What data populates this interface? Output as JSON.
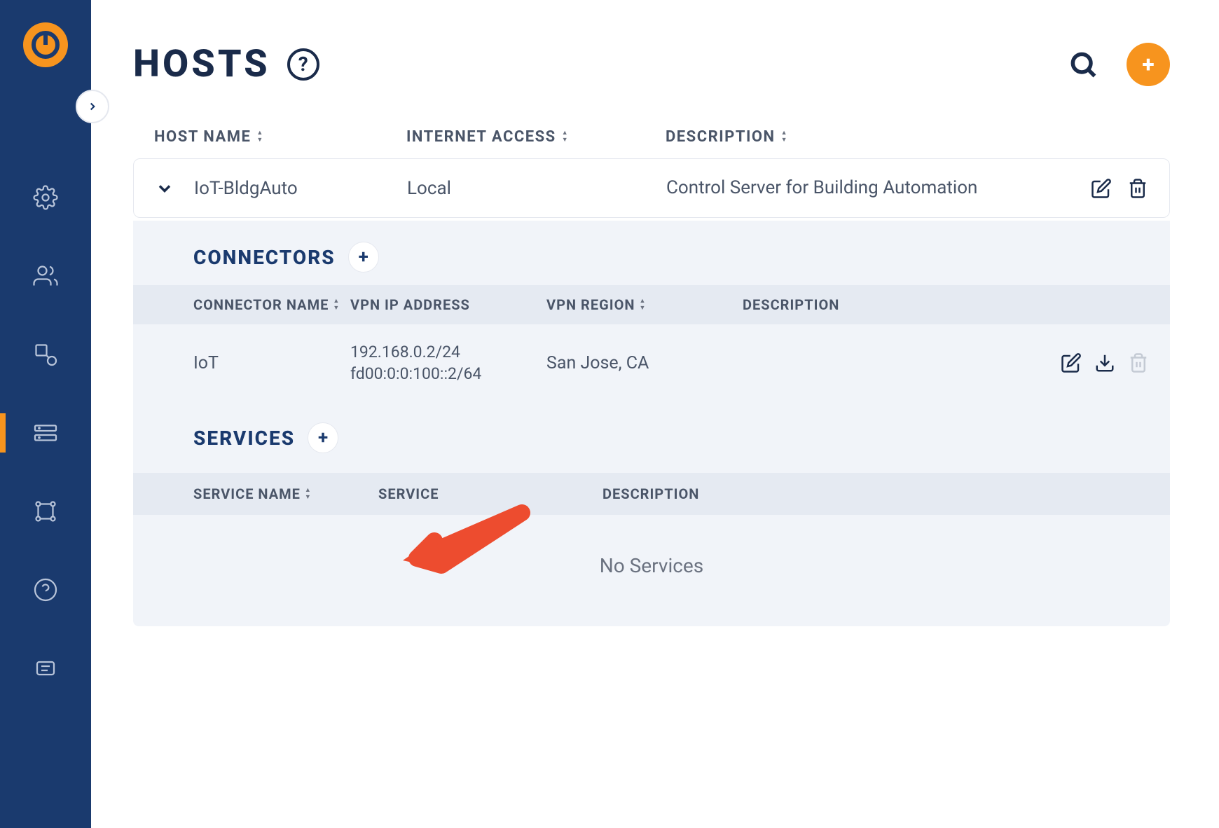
{
  "page": {
    "title": "HOSTS"
  },
  "columns": {
    "hostname": "HOST NAME",
    "internet": "INTERNET ACCESS",
    "description": "DESCRIPTION"
  },
  "host": {
    "name": "IoT-BldgAuto",
    "internet": "Local",
    "description": "Control Server for Building Automation"
  },
  "connectors": {
    "title": "CONNECTORS",
    "columns": {
      "name": "CONNECTOR NAME",
      "ip": "VPN IP ADDRESS",
      "region": "VPN REGION",
      "description": "DESCRIPTION"
    },
    "row": {
      "name": "IoT",
      "ip_v4": "192.168.0.2/24",
      "ip_v6": "fd00:0:0:100::2/64",
      "region": "San Jose, CA"
    }
  },
  "services": {
    "title": "SERVICES",
    "columns": {
      "name": "SERVICE NAME",
      "service": "SERVICE",
      "description": "DESCRIPTION"
    },
    "empty": "No Services"
  }
}
